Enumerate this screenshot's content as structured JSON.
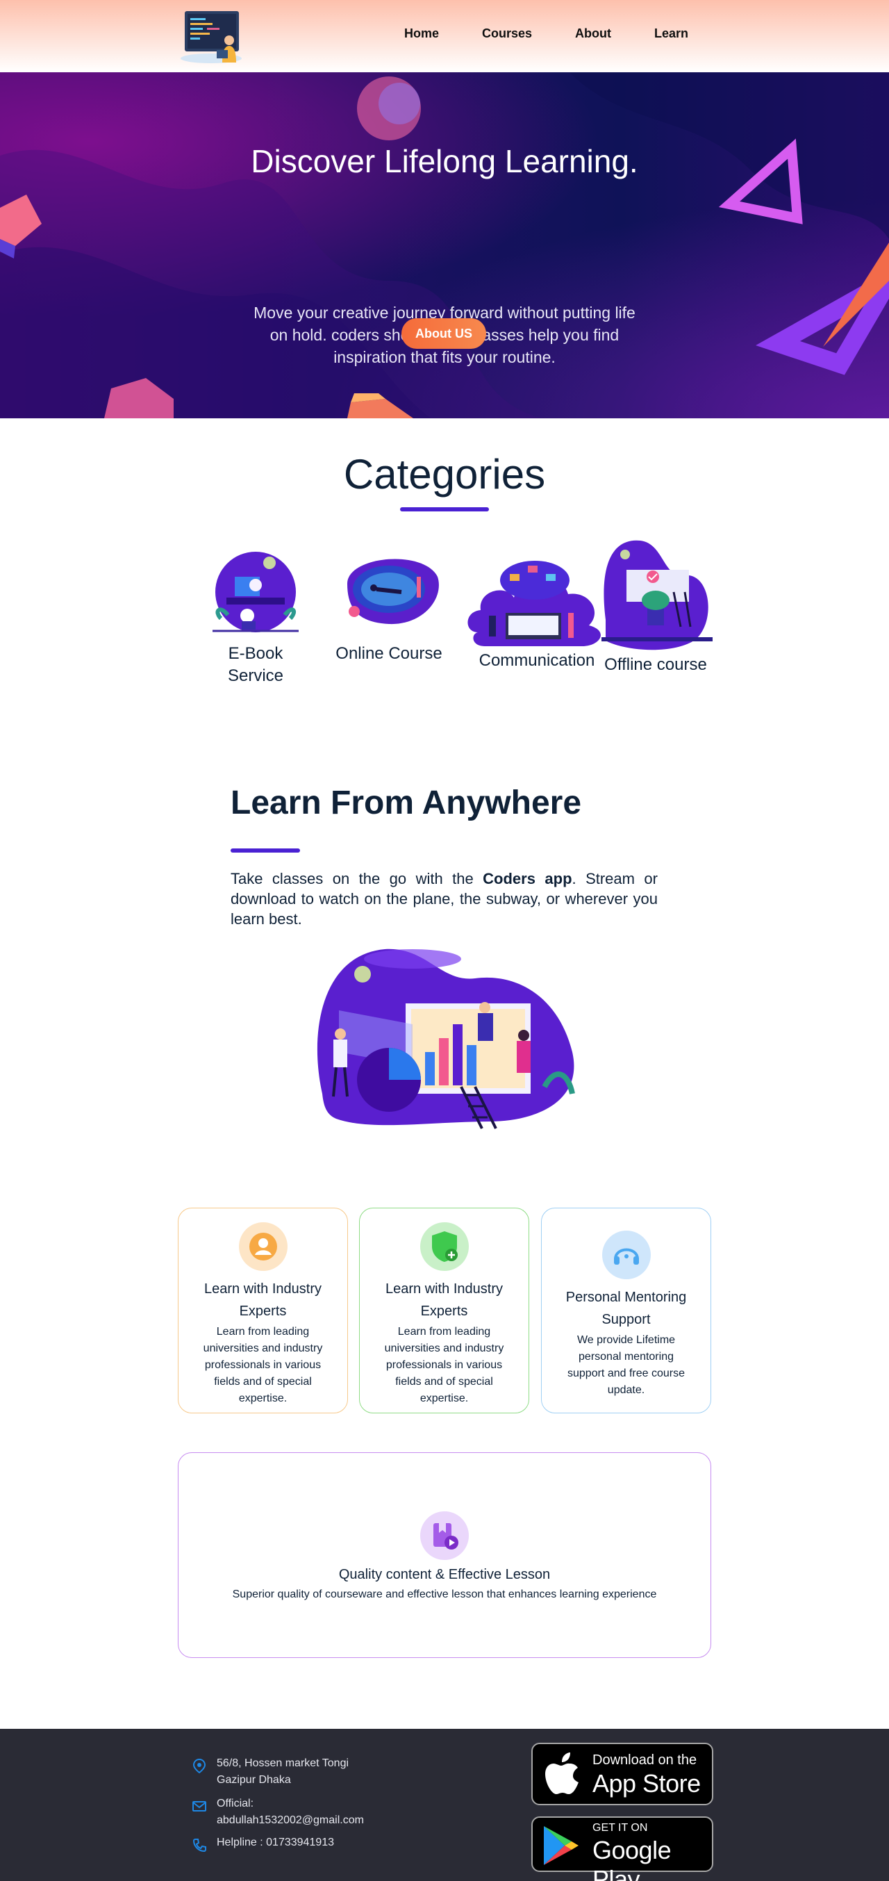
{
  "nav": {
    "logo_alt": "Coders logo",
    "items": [
      {
        "label": "Home"
      },
      {
        "label": "Courses"
      },
      {
        "label": "About"
      },
      {
        "label": "Learn"
      }
    ]
  },
  "hero": {
    "title": "Discover Lifelong Learning.",
    "subtitle": "Move your creative journey forward without putting life on hold. coders short online classes help you find inspiration that fits your routine.",
    "button_label": "About US",
    "accent": "#f56b3a",
    "background": "#0f1258"
  },
  "categories": {
    "title": "Categories",
    "accent": "#4a21d3",
    "items": [
      {
        "label": "E-Book Service",
        "icon": "ebook-illustration"
      },
      {
        "label": "Online Course",
        "icon": "online-course-illustration"
      },
      {
        "label": "Communication",
        "icon": "cloud-communication-illustration"
      },
      {
        "label": "Offline course",
        "icon": "offline-course-illustration"
      }
    ]
  },
  "learn": {
    "title": "Learn From Anywhere",
    "text_before": "Take classes on the go with the ",
    "text_bold": "Coders app",
    "text_after": ". Stream or download to watch on the plane, the subway, or wherever you learn best.",
    "illustration": "data-analytics-illustration"
  },
  "features": [
    {
      "title": "Learn with Industry Experts",
      "text": "Learn from leading universities and industry professionals in various fields and of special expertise.",
      "icon": "user-icon",
      "color": "#f7a944",
      "tint": "#fde5c6"
    },
    {
      "title": "Learn with Industry Experts",
      "text": "Learn from leading universities and industry professionals in various fields and of special expertise.",
      "icon": "shield-plus-icon",
      "color": "#3fc94e",
      "tint": "#c9f0c8"
    },
    {
      "title": "Personal Mentoring Support",
      "text": "We provide Lifetime personal mentoring support and free course update.",
      "icon": "headset-icon",
      "color": "#4aa7f0",
      "tint": "#cfe6fb"
    }
  ],
  "quality": {
    "title": "Quality content & Effective Lesson",
    "text": "Superior quality of courseware and effective lesson that enhances learning experience",
    "icon": "bookmark-video-icon",
    "color": "#a45ce8",
    "tint": "#ead7fb"
  },
  "footer": {
    "address": "56/8, Hossen market Tongi Gazipur Dhaka",
    "email": "Official: abdullah1532002@gmail.com",
    "helpline": "Helpline : 01733941913",
    "app_store_small": "Download on the",
    "app_store_big": "App Store",
    "google_small": "GET IT ON",
    "google_big": "Google Play",
    "icon_color": "#1e88e5"
  }
}
